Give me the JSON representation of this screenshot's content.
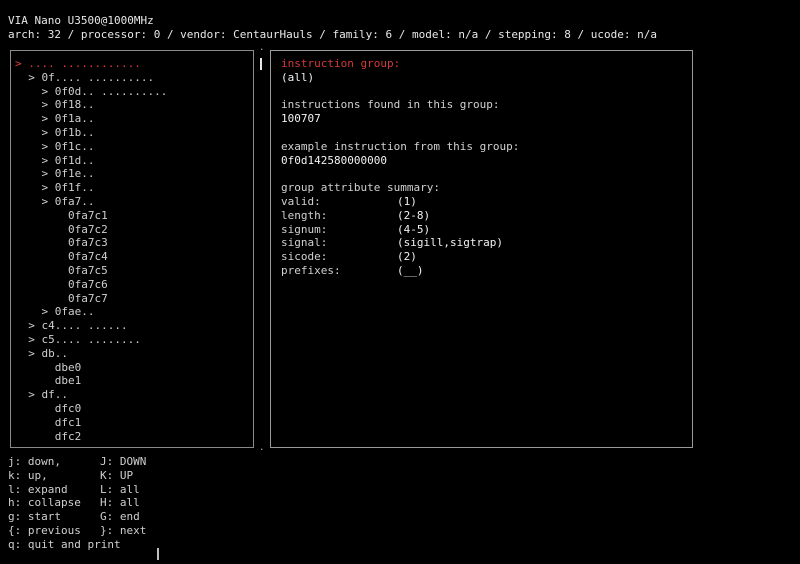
{
  "header": {
    "cpu_name": "VIA Nano U3500@1000MHz",
    "cpu_info": "arch: 32 / processor: 0 / vendor: CentaurHauls / family: 6 / model: n/a / stepping: 8 / ucode: n/a"
  },
  "tree": [
    {
      "text": "> .... ............",
      "selected": true
    },
    {
      "text": "  > 0f.... ..........",
      "selected": false
    },
    {
      "text": "    > 0f0d.. ..........",
      "selected": false
    },
    {
      "text": "    > 0f18..",
      "selected": false
    },
    {
      "text": "    > 0f1a..",
      "selected": false
    },
    {
      "text": "    > 0f1b..",
      "selected": false
    },
    {
      "text": "    > 0f1c..",
      "selected": false
    },
    {
      "text": "    > 0f1d..",
      "selected": false
    },
    {
      "text": "    > 0f1e..",
      "selected": false
    },
    {
      "text": "    > 0f1f..",
      "selected": false
    },
    {
      "text": "    > 0fa7..",
      "selected": false
    },
    {
      "text": "        0fa7c1",
      "selected": false
    },
    {
      "text": "        0fa7c2",
      "selected": false
    },
    {
      "text": "        0fa7c3",
      "selected": false
    },
    {
      "text": "        0fa7c4",
      "selected": false
    },
    {
      "text": "        0fa7c5",
      "selected": false
    },
    {
      "text": "        0fa7c6",
      "selected": false
    },
    {
      "text": "        0fa7c7",
      "selected": false
    },
    {
      "text": "    > 0fae..",
      "selected": false
    },
    {
      "text": "  > c4.... ......",
      "selected": false
    },
    {
      "text": "  > c5.... ........",
      "selected": false
    },
    {
      "text": "  > db..",
      "selected": false
    },
    {
      "text": "      dbe0",
      "selected": false
    },
    {
      "text": "      dbe1",
      "selected": false
    },
    {
      "text": "  > df..",
      "selected": false
    },
    {
      "text": "      dfc0",
      "selected": false
    },
    {
      "text": "      dfc1",
      "selected": false
    },
    {
      "text": "      dfc2",
      "selected": false
    }
  ],
  "detail": {
    "group_title": "instruction group:",
    "group_value": "(all)",
    "found_title": "instructions found in this group:",
    "found_value": "100707",
    "example_title": "example instruction from this group:",
    "example_value": "0f0d142580000000",
    "summary_title": "group attribute summary:",
    "attributes": [
      {
        "key": "valid:",
        "value": "(1)"
      },
      {
        "key": "length:",
        "value": "(2-8)"
      },
      {
        "key": "signum:",
        "value": "(4-5)"
      },
      {
        "key": "signal:",
        "value": "(sigill,sigtrap)"
      },
      {
        "key": "sicode:",
        "value": "(2)"
      },
      {
        "key": "prefixes:",
        "value": "(__)"
      }
    ]
  },
  "help": [
    {
      "left": "j: down,",
      "right": "J: DOWN"
    },
    {
      "left": "k: up,",
      "right": "K: UP"
    },
    {
      "left": "l: expand",
      "right": "L: all"
    },
    {
      "left": "h: collapse",
      "right": "H: all"
    },
    {
      "left": "g: start",
      "right": "G: end"
    },
    {
      "left": "{: previous",
      "right": "}: next"
    },
    {
      "left": "q: quit and print",
      "right": ""
    }
  ]
}
